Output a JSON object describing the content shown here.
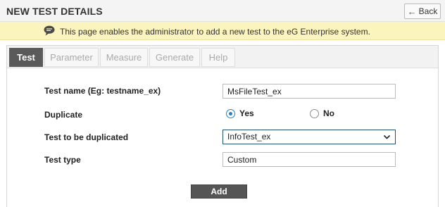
{
  "header": {
    "title": "NEW TEST DETAILS",
    "back_label": "Back"
  },
  "info_bar": {
    "icon": "speech-bubble-icon",
    "message": "This page enables the administrator to add a new test to the eG Enterprise system."
  },
  "tabs": [
    {
      "label": "Test",
      "active": true
    },
    {
      "label": "Parameter",
      "active": false
    },
    {
      "label": "Measure",
      "active": false
    },
    {
      "label": "Generate",
      "active": false
    },
    {
      "label": "Help",
      "active": false
    }
  ],
  "form": {
    "test_name": {
      "label": "Test name (Eg: testname_ex)",
      "value": "MsFileTest_ex"
    },
    "duplicate": {
      "label": "Duplicate",
      "options": [
        {
          "label": "Yes",
          "selected": true
        },
        {
          "label": "No",
          "selected": false
        }
      ]
    },
    "duplicated_test": {
      "label": "Test to be duplicated",
      "selected": "InfoTest_ex"
    },
    "test_type": {
      "label": "Test type",
      "value": "Custom"
    },
    "add_label": "Add"
  },
  "colors": {
    "info_bar_bg": "#fbf4bd",
    "active_tab_bg": "#5a5a5a",
    "radio_accent": "#2a80c4",
    "add_button_bg": "#555555"
  }
}
